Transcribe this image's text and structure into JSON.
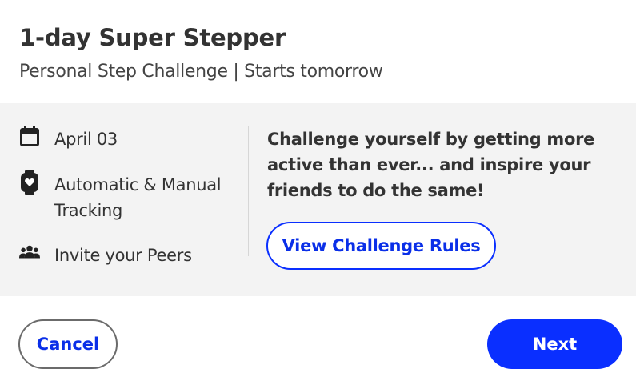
{
  "dialog": {
    "title": "1-day Super Stepper",
    "subtitle": "Personal Step Challenge | Starts tomorrow"
  },
  "features": [
    {
      "icon": "calendar-icon",
      "label": "April 03"
    },
    {
      "icon": "smartwatch-heart-icon",
      "label": "Automatic & Manual Tracking"
    },
    {
      "icon": "people-group-icon",
      "label": "Invite your Peers"
    }
  ],
  "description": "Challenge yourself by getting more active than ever... and inspire your friends to do the same!",
  "buttons": {
    "rules_label": "View Challenge Rules",
    "cancel_label": "Cancel",
    "next_label": "Next"
  },
  "colors": {
    "accent": "#0a2fff",
    "panel_background": "#f3f3f3",
    "text": "#333333"
  }
}
